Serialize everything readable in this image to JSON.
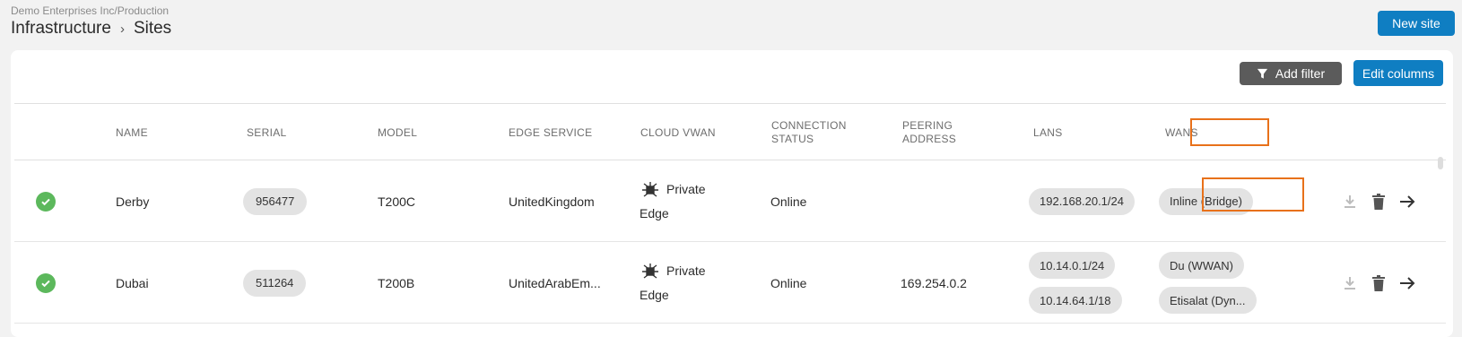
{
  "header": {
    "org_path": "Demo Enterprises Inc/Production",
    "breadcrumb": [
      "Infrastructure",
      "Sites"
    ],
    "breadcrumb_sep": "›",
    "new_site_label": "New site"
  },
  "toolbar": {
    "add_filter_label": "Add filter",
    "edit_columns_label": "Edit columns"
  },
  "table": {
    "columns": [
      "NAME",
      "SERIAL",
      "MODEL",
      "EDGE SERVICE",
      "CLOUD VWAN",
      "CONNECTION STATUS",
      "PEERING ADDRESS",
      "LANS",
      "WANS"
    ],
    "rows": [
      {
        "status": "online",
        "name": "Derby",
        "serial": "956477",
        "model": "T200C",
        "edge_service": "UnitedKingdom",
        "cloud_vwan": "Private Edge",
        "connection_status": "Online",
        "peering_address": "",
        "lans": [
          "192.168.20.1/24"
        ],
        "wans": [
          "Inline (Bridge)"
        ]
      },
      {
        "status": "online",
        "name": "Dubai",
        "serial": "511264",
        "model": "T200B",
        "edge_service": "UnitedArabEm...",
        "cloud_vwan": "Private Edge",
        "connection_status": "Online",
        "peering_address": "169.254.0.2",
        "lans": [
          "10.14.0.1/24",
          "10.14.64.1/18"
        ],
        "wans": [
          "Du (WWAN)",
          "Etisalat (Dyn..."
        ]
      }
    ]
  },
  "colors": {
    "primary": "#0f7ec2",
    "filter_button": "#5b5b5b",
    "status_ok": "#5cb85c",
    "highlight": "#e8711a",
    "chip": "#e3e3e3"
  },
  "icons": {
    "filter": "filter-icon",
    "status": "check-circle-icon",
    "cloud": "network-hub-icon",
    "download": "download-icon",
    "delete": "trash-icon",
    "open": "arrow-right-icon"
  }
}
